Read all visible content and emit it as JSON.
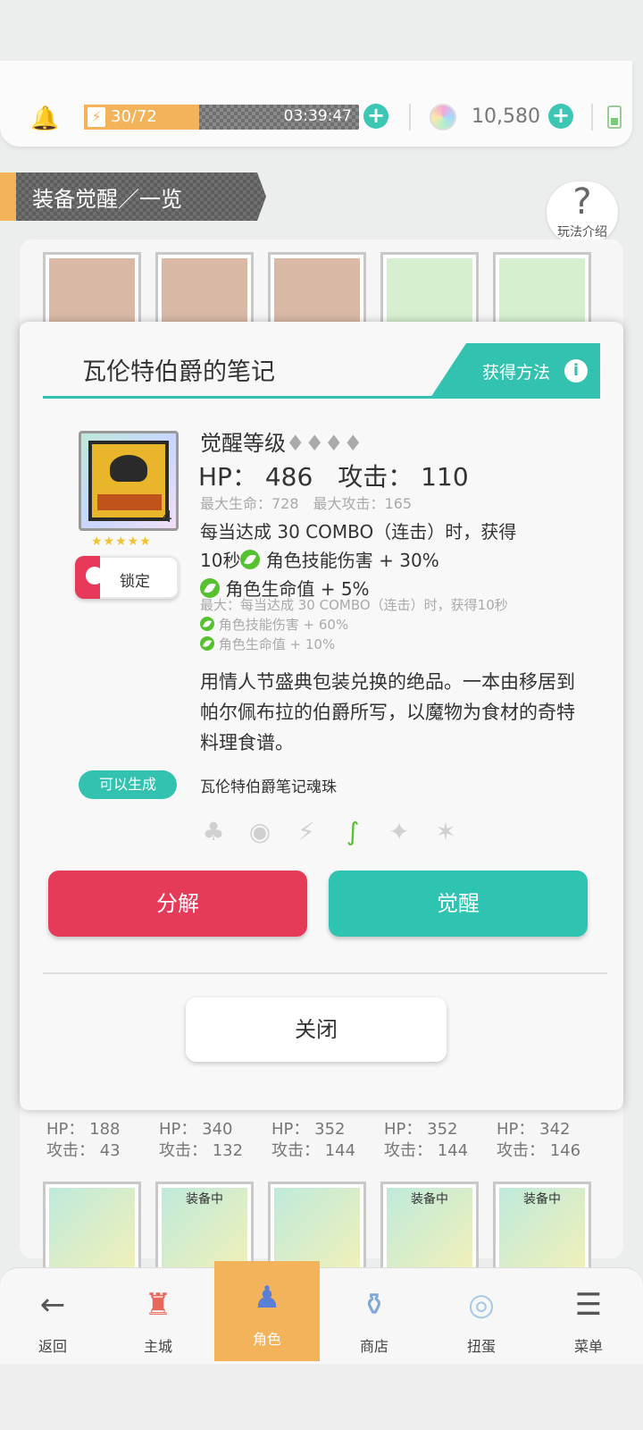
{
  "topbar": {
    "stamina": "30/72",
    "stamina_fraction": 0.42,
    "timer": "03:39:47",
    "gems": "10,580"
  },
  "header": {
    "title": "装备觉醒／一览",
    "help_label": "玩法介绍",
    "help_symbol": "?"
  },
  "grid": {
    "stats": [
      {
        "hp": "HP： 188",
        "atk": "攻击： 43"
      },
      {
        "hp": "HP： 340",
        "atk": "攻击： 132"
      },
      {
        "hp": "HP： 352",
        "atk": "攻击： 144"
      },
      {
        "hp": "HP： 352",
        "atk": "攻击： 144"
      },
      {
        "hp": "HP： 342",
        "atk": "攻击： 146"
      }
    ],
    "equipped_label": "装备中"
  },
  "modal": {
    "title": "瓦伦特伯爵的笔记",
    "obtain_label": "获得方法",
    "obtain_icon": "i",
    "quantity": "4",
    "stars": "★★★★★",
    "lock_label": "锁定",
    "awaken_label": "觉醒等级",
    "awaken_diamonds": "♦♦♦♦",
    "hp_atk": "HP： 486　攻击： 110",
    "max_line": "最大生命：728　最大攻击：165",
    "skill_line1": "每当达成 30 COMBO（连击）时，获得",
    "skill_line2_pre": "10秒",
    "skill_line2_post": " 角色技能伤害 + 30%",
    "skill_line3": " 角色生命值 + 5%",
    "skill_max1": "最大：每当达成 30 COMBO（连击）时，获得10秒",
    "skill_max2": " 角色技能伤害 + 60%",
    "skill_max3": " 角色生命值 + 10%",
    "description": "用情人节盛典包装兑换的绝品。一本由移居到帕尔佩布拉的伯爵所写，以魔物为食材的奇特料理食谱。",
    "gen_badge": "可以生成",
    "gen_name": "瓦伦特伯爵笔记魂珠",
    "btn_decompose": "分解",
    "btn_awaken": "觉醒",
    "btn_close": "关闭"
  },
  "nav": {
    "items": [
      {
        "label": "返回",
        "icon": "back-arrow-icon"
      },
      {
        "label": "主城",
        "icon": "castle-icon"
      },
      {
        "label": "角色",
        "icon": "character-icon"
      },
      {
        "label": "商店",
        "icon": "shop-icon"
      },
      {
        "label": "扭蛋",
        "icon": "gacha-icon"
      },
      {
        "label": "菜单",
        "icon": "menu-icon"
      }
    ]
  },
  "colors": {
    "accent": "#34c2b0",
    "danger": "#e53a58",
    "orange": "#f3b35b"
  }
}
